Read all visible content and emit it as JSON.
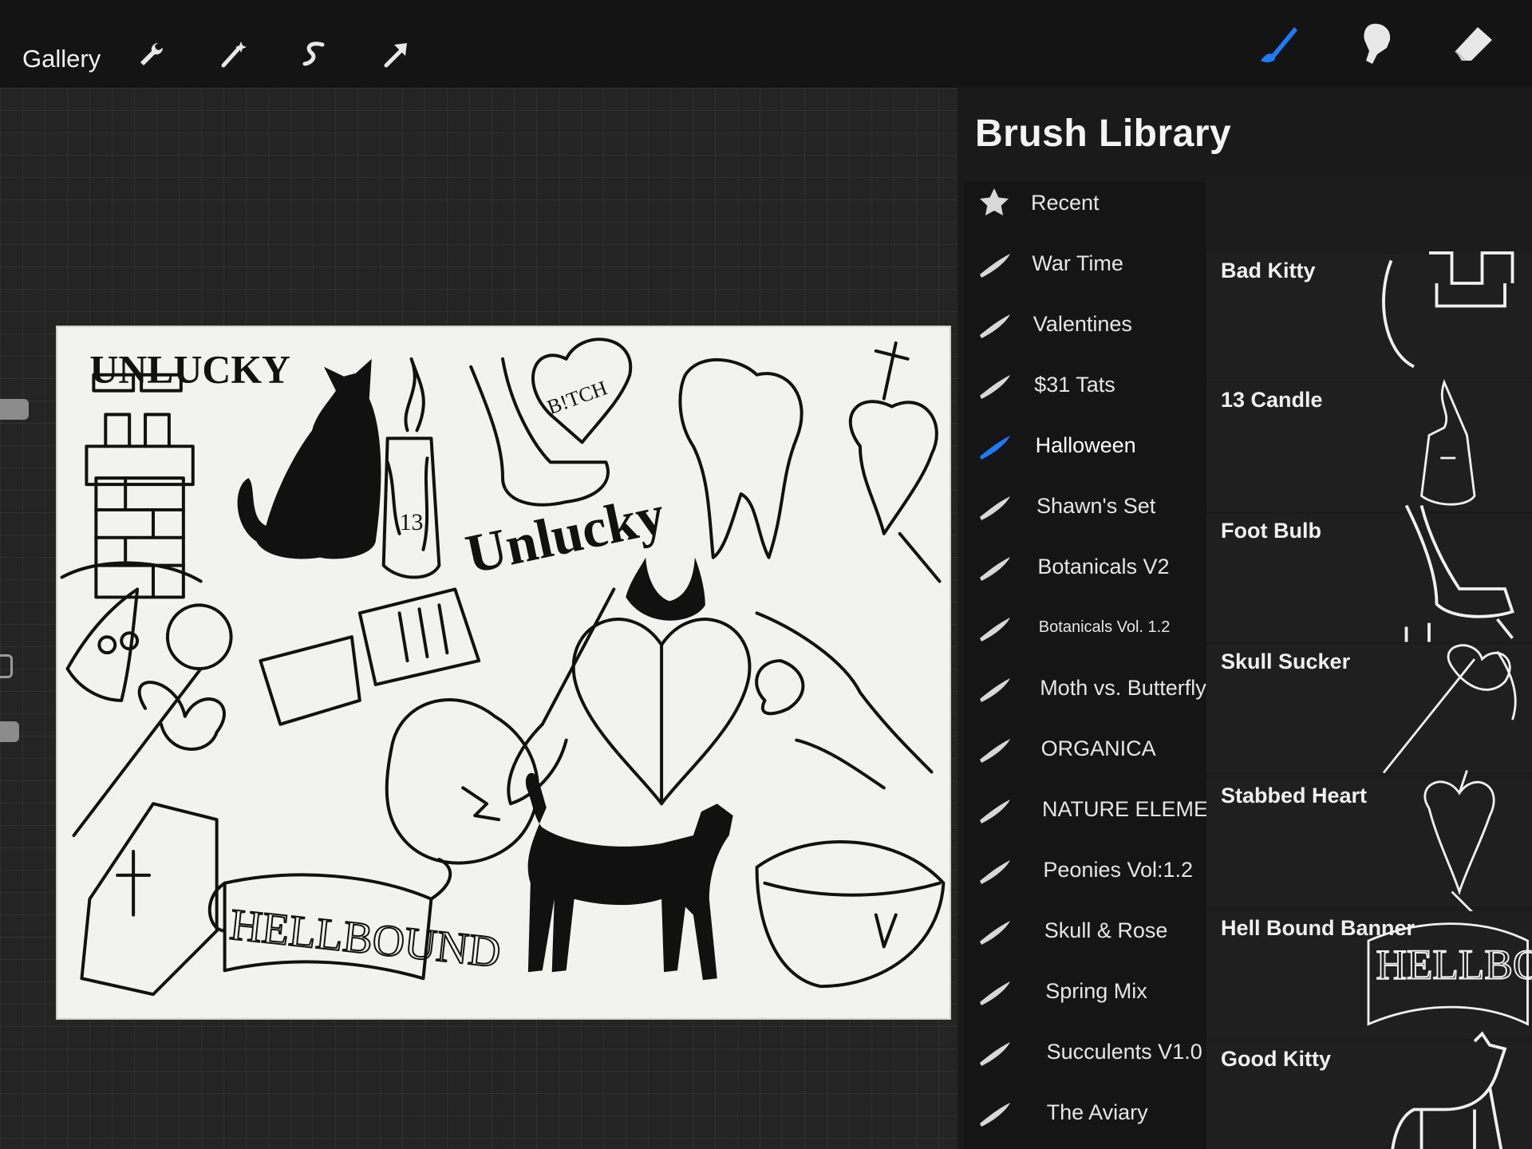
{
  "toolbar": {
    "gallery_label": "Gallery",
    "left_tools": [
      "wrench-icon",
      "magic-wand-icon",
      "selection-icon",
      "transform-arrow-icon"
    ],
    "right_tools": [
      "brush-icon",
      "smudge-icon",
      "eraser-icon"
    ],
    "active_tool_color": "#1e7bff"
  },
  "canvas": {
    "texts": {
      "unlucky_top": "UNLUCKY",
      "unlucky_script": "Unlucky",
      "heart_text": "B!TCH",
      "candle_number": "13",
      "banner": "HELLBOUND"
    }
  },
  "brush_library": {
    "title": "Brush Library",
    "categories": [
      {
        "label": "Recent",
        "icon": "star-icon"
      },
      {
        "label": "War Time",
        "icon": "brush-stroke-icon"
      },
      {
        "label": "Valentines",
        "icon": "brush-stroke-icon"
      },
      {
        "label": "$31 Tats",
        "icon": "brush-stroke-icon"
      },
      {
        "label": "Halloween",
        "icon": "brush-stroke-icon",
        "selected": true
      },
      {
        "label": "Shawn's Set",
        "icon": "brush-stroke-icon"
      },
      {
        "label": "Botanicals V2",
        "icon": "brush-stroke-icon"
      },
      {
        "label": "Botanicals Vol. 1.2",
        "icon": "brush-stroke-icon"
      },
      {
        "label": "Moth vs. Butterfly",
        "icon": "brush-stroke-icon"
      },
      {
        "label": "ORGANICA",
        "icon": "brush-stroke-icon"
      },
      {
        "label": "NATURE ELEMENTS...",
        "icon": "brush-stroke-icon"
      },
      {
        "label": "Peonies Vol:1.2",
        "icon": "brush-stroke-icon"
      },
      {
        "label": "Skull & Rose",
        "icon": "brush-stroke-icon"
      },
      {
        "label": "Spring Mix",
        "icon": "brush-stroke-icon"
      },
      {
        "label": "Succulents V1.0",
        "icon": "brush-stroke-icon"
      },
      {
        "label": "The Aviary",
        "icon": "brush-stroke-icon"
      }
    ],
    "brushes": [
      {
        "name": "Bad Kitty"
      },
      {
        "name": "13 Candle"
      },
      {
        "name": "Foot Bulb"
      },
      {
        "name": "Skull Sucker"
      },
      {
        "name": "Stabbed Heart"
      },
      {
        "name": "Hell Bound Banner",
        "preview_text": "HELLBOUN"
      },
      {
        "name": "Good Kitty"
      }
    ]
  }
}
